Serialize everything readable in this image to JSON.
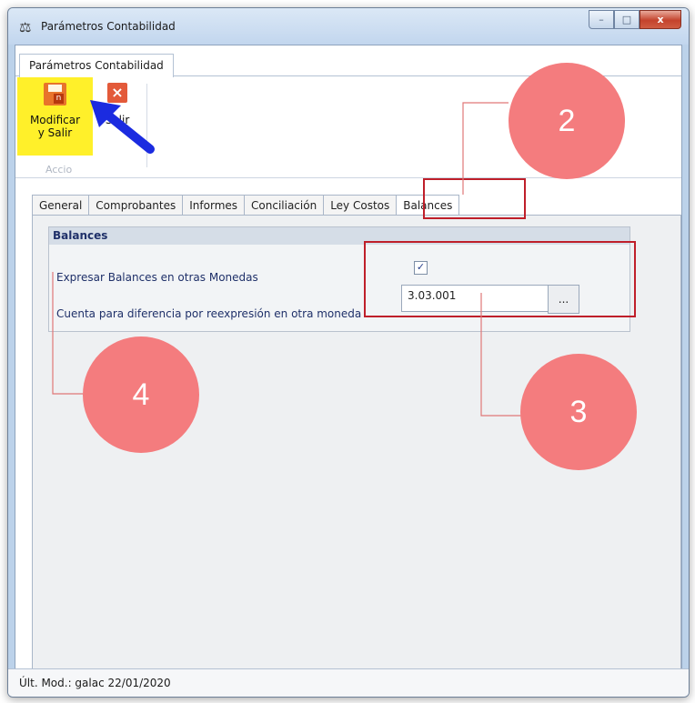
{
  "window": {
    "title": "Parámetros Contabilidad",
    "controls": {
      "minimize": "–",
      "maximize": "□",
      "close": "x"
    }
  },
  "ribbon": {
    "tab": "Parámetros Contabilidad",
    "modify_button": {
      "line1": "Modificar",
      "line2": "y Salir"
    },
    "exit_button": "Salir",
    "group_label": "Accio"
  },
  "tabs": [
    "General",
    "Comprobantes",
    "Informes",
    "Conciliación",
    "Ley Costos",
    "Balances"
  ],
  "active_tab": "Balances",
  "balances": {
    "header": "Balances",
    "express_label": "Expresar Balances en otras Monedas",
    "express_checked": "✓",
    "account_label": "Cuenta para diferencia por reexpresión en otra moneda",
    "account_value": "3.03.001",
    "browse_label": "..."
  },
  "status": "Últ. Mod.:  galac  22/01/2020",
  "annotations": {
    "c2": "2",
    "c3": "3",
    "c4": "4"
  },
  "colors": {
    "annotation_circle": "#f47c7e",
    "annotation_box": "#bf1f2a",
    "highlight": "#fff02a",
    "arrow": "#1b2be0"
  }
}
